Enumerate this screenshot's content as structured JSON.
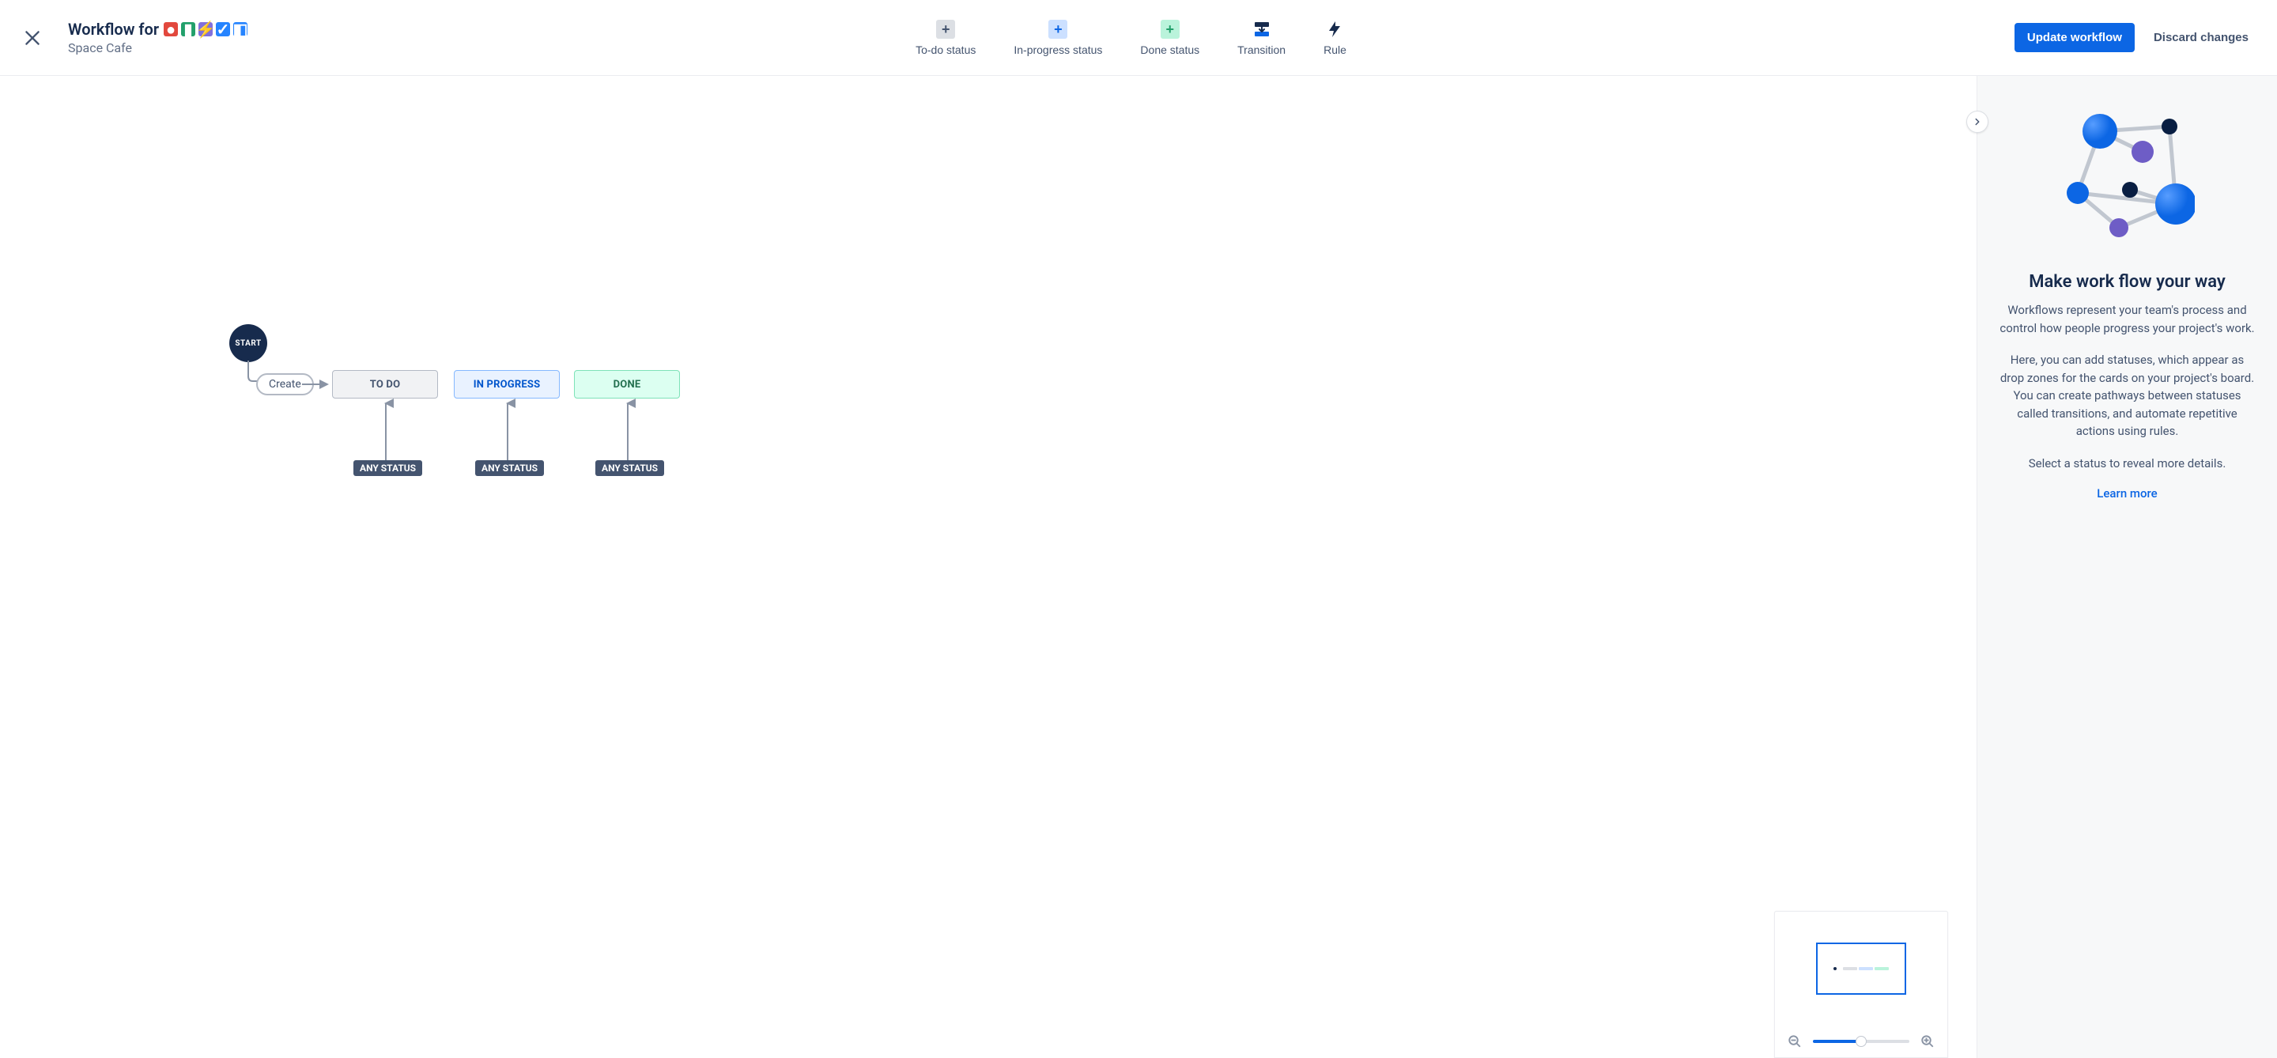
{
  "header": {
    "title_prefix": "Workflow for",
    "subtitle": "Space Cafe",
    "icons": [
      {
        "color": "#e2483d",
        "name": "issue-type-bug"
      },
      {
        "color": "#22a06b",
        "name": "issue-type-story"
      },
      {
        "color": "#8270db",
        "name": "issue-type-epic"
      },
      {
        "color": "#2684ff",
        "name": "issue-type-task"
      },
      {
        "color": "#2684ff",
        "name": "issue-type-subtask"
      }
    ],
    "icon_glyphs": [
      "●",
      "▮",
      "⚡",
      "✓",
      "◧"
    ]
  },
  "toolbar": {
    "todo_label": "To-do status",
    "inprog_label": "In-progress status",
    "done_label": "Done status",
    "transition_label": "Transition",
    "rule_label": "Rule"
  },
  "actions": {
    "update_label": "Update workflow",
    "discard_label": "Discard changes"
  },
  "canvas": {
    "start_label": "START",
    "create_label": "Create",
    "statuses": {
      "todo": "TO DO",
      "inprog": "IN PROGRESS",
      "done": "DONE"
    },
    "any_status_label": "ANY STATUS"
  },
  "panel": {
    "heading": "Make work flow your way",
    "p1": "Workflows represent your team's process and control how people progress your project's work.",
    "p2": "Here, you can add statuses, which appear as drop zones for the cards on your project's board. You can create pathways between statuses called transitions, and automate repetitive actions using rules.",
    "p3": "Select a status to reveal more details.",
    "learn_more": "Learn more"
  },
  "minimap": {
    "zoom_percent": 50
  }
}
